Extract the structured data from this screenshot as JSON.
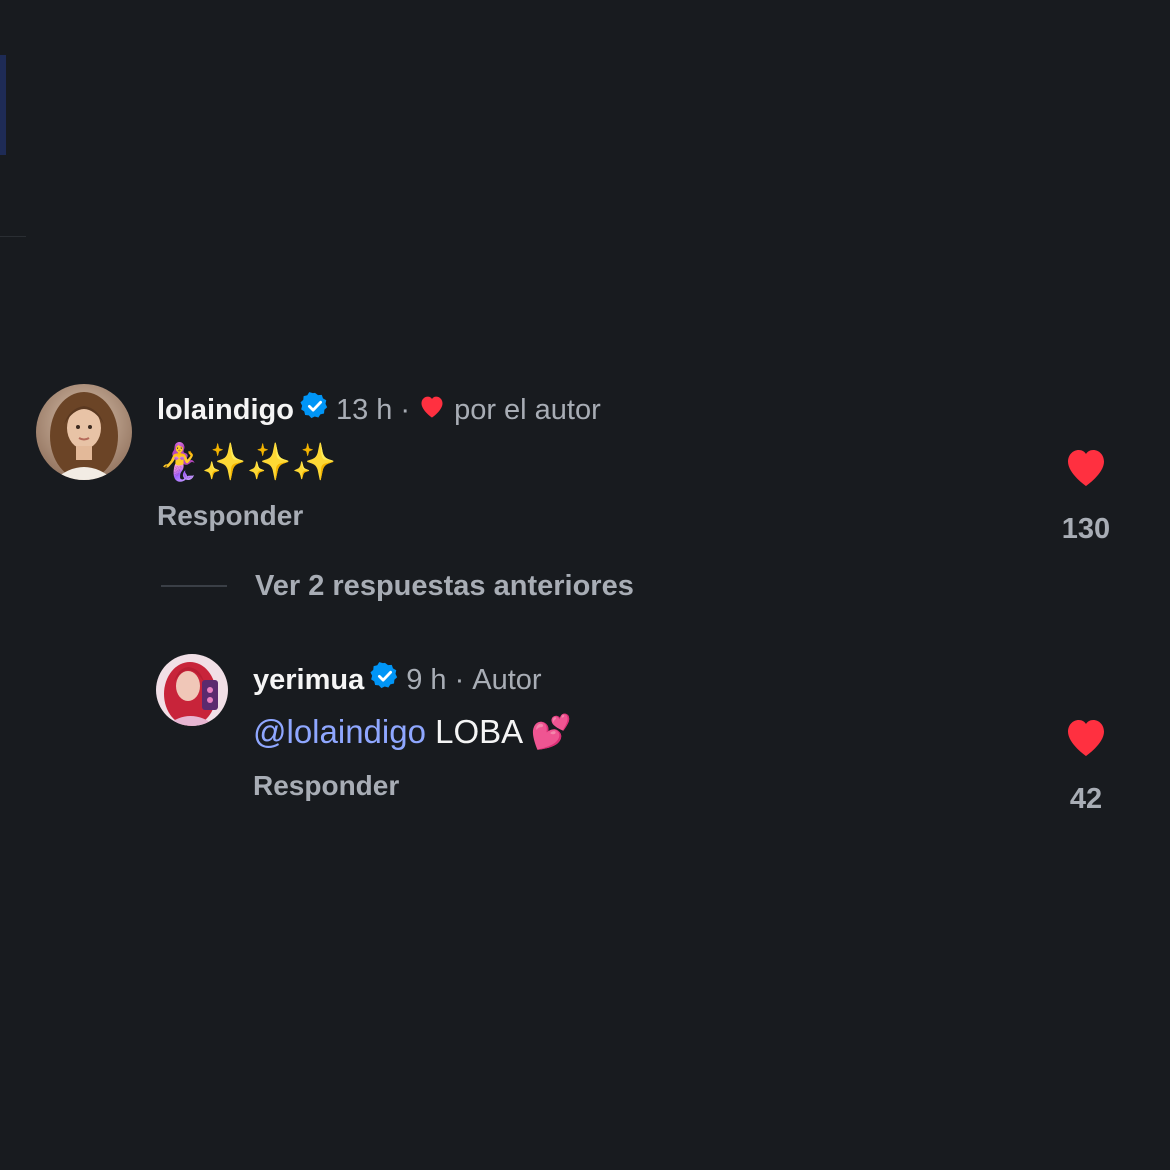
{
  "comments": [
    {
      "username": "lolaindigo",
      "time": "13 h",
      "separator": "·",
      "liked_by_author_text": "por el autor",
      "text": "🧜‍♀️✨✨✨",
      "reply_label": "Responder",
      "likes": "130"
    }
  ],
  "view_replies_label": "Ver 2 respuestas anteriores",
  "reply": {
    "username": "yerimua",
    "time": "9 h",
    "separator": "·",
    "author_label": "Autor",
    "mention": "@lolaindigo",
    "text": "LOBA 💕",
    "reply_label": "Responder",
    "likes": "42"
  },
  "colors": {
    "background": "#181b1f",
    "heart": "#ff3040",
    "verified": "#0095f6",
    "mention": "#8fa7ff",
    "secondary_text": "#a8adb5"
  },
  "icons": {
    "verified": "verified-badge-icon",
    "like": "heart-icon"
  }
}
